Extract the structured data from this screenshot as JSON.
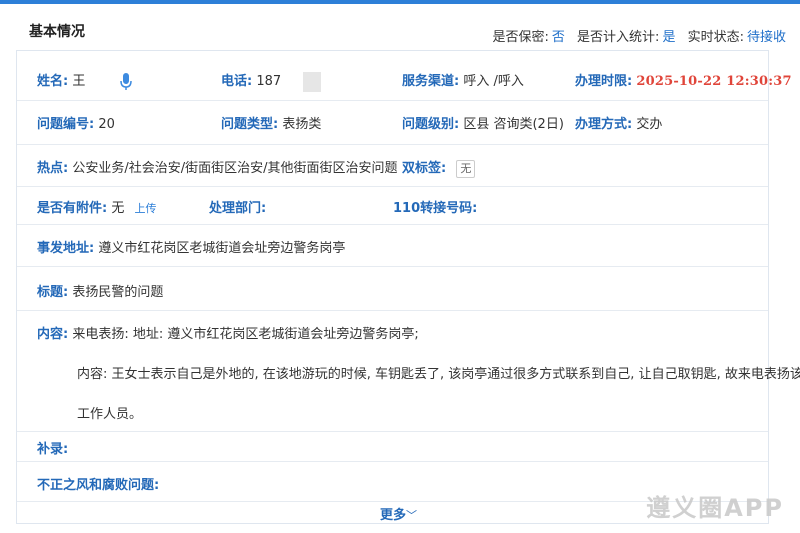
{
  "header": {
    "title": "基本情况",
    "confidential_label": "是否保密:",
    "confidential_value": "否",
    "stats_label": "是否计入统计:",
    "stats_value": "是",
    "status_label": "实时状态:",
    "status_value": "待接收"
  },
  "fields": {
    "name_label": "姓名:",
    "name_value": "王",
    "phone_label": "电话:",
    "phone_value": "187",
    "channel_label": "服务渠道:",
    "channel_value": "呼入 /呼入",
    "deadline_label": "办理时限:",
    "deadline_value": "2025-10-22 12:30:37",
    "issue_no_label": "问题编号:",
    "issue_no_value": "20",
    "issue_type_label": "问题类型:",
    "issue_type_value": "表扬类",
    "issue_level_label": "问题级别:",
    "issue_level_value": "区县 咨询类(2日)",
    "method_label": "办理方式:",
    "method_value": "交办",
    "hotspot_label": "热点:",
    "hotspot_value": "公安业务/社会治安/街面街区治安/其他街面街区治安问题",
    "dual_tag_label": "双标签:",
    "dual_tag_value": "无",
    "attachment_label": "是否有附件:",
    "attachment_value": "无",
    "upload_label": "上传",
    "dept_label": "处理部门:",
    "transfer_label": "110转接号码:",
    "address_label": "事发地址:",
    "address_value": "遵义市红花岗区老城街道会址旁边警务岗亭",
    "subject_label": "标题:",
    "subject_value": "表扬民警的问题",
    "content_label": "内容:",
    "content_line1": "来电表扬: 地址: 遵义市红花岗区老城街道会址旁边警务岗亭;",
    "content_line2": "内容: 王女士表示自己是外地的, 在该地游玩的时候, 车钥匙丢了, 该岗亭通过很多方式联系到自己, 让自己取钥匙, 故来电表扬该地的",
    "content_line3": "工作人员。",
    "supplement_label": "补录:",
    "misconduct_label": "不正之风和腐败问题:"
  },
  "more_label": "更多",
  "watermark": "遵义圈APP",
  "colors": {
    "accent": "#2469b8",
    "deadline": "#e0453a",
    "topbar": "#2d7fd8"
  }
}
